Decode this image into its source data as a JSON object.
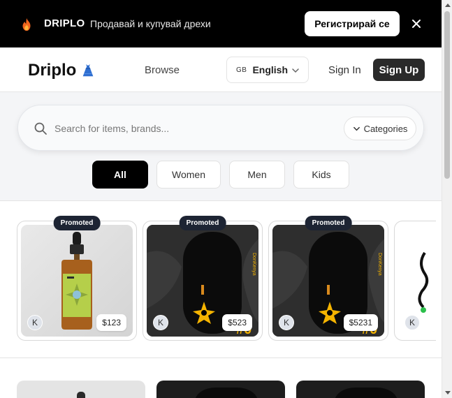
{
  "promo": {
    "brand": "DRIPLO",
    "tagline": "Продавай и купувай дрехи",
    "register_label": "Регистрирай се",
    "flame_icon": "flame-icon",
    "close_icon": "close-icon"
  },
  "header": {
    "logo": "Driplo",
    "logo_icon": "dress-icon",
    "browse_label": "Browse",
    "language": {
      "code": "GB",
      "name": "English"
    },
    "signin_label": "Sign In",
    "signup_label": "Sign Up"
  },
  "search": {
    "placeholder": "Search for items, brands...",
    "categories_label": "Categories"
  },
  "filters": [
    {
      "label": "All",
      "active": true
    },
    {
      "label": "Women",
      "active": false
    },
    {
      "label": "Men",
      "active": false
    },
    {
      "label": "Kids",
      "active": false
    }
  ],
  "listings": [
    {
      "badge": "Promoted",
      "price": "$123",
      "seller_initial": "K",
      "image": "serum-bottle"
    },
    {
      "badge": "Promoted",
      "price": "$523",
      "seller_initial": "K",
      "image": "black-phone-case"
    },
    {
      "badge": "Promoted",
      "price": "$5231",
      "seller_initial": "K",
      "image": "black-phone-case"
    },
    {
      "badge": "",
      "price": "",
      "seller_initial": "K",
      "image": "black-squiggle-item"
    }
  ],
  "colors": {
    "banner_bg": "#000000",
    "primary_button": "#2a2a2a",
    "badge_bg": "#1d2433",
    "accent_yellow": "#f5b400"
  }
}
